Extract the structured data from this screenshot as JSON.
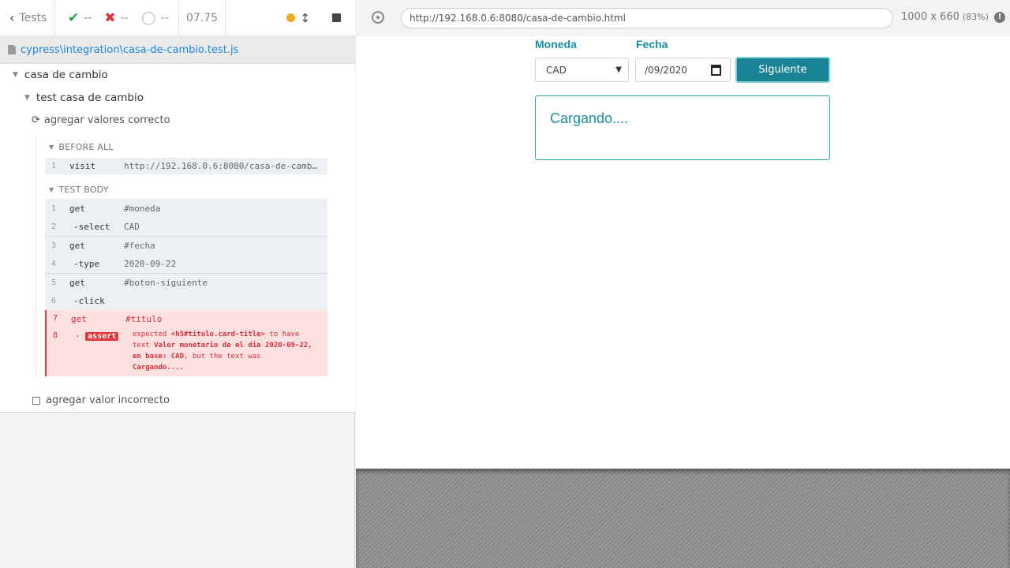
{
  "reporter": {
    "tests_label": "Tests",
    "passed": "--",
    "failed": "--",
    "pending": "--",
    "duration": "07.75",
    "spec_file": "cypress\\integration\\casa-de-cambio.test.js",
    "suite": "casa de cambio",
    "subsuite": "test casa de cambio",
    "test_active": "agregar valores correcto",
    "test_other": "agregar valor incorrecto",
    "before_all_label": "BEFORE ALL",
    "test_body_label": "TEST BODY",
    "before_all_cmds": [
      {
        "num": "1",
        "name": "visit",
        "msg": "http://192.168.0.6:8080/casa-de-cambio.html"
      }
    ],
    "body_cmds": [
      {
        "num": "1",
        "name": "get",
        "msg": "#moneda"
      },
      {
        "num": "2",
        "name": "-select",
        "msg": "CAD"
      },
      {
        "num": "3",
        "name": "get",
        "msg": "#fecha"
      },
      {
        "num": "4",
        "name": "-type",
        "msg": "2020-09-22"
      },
      {
        "num": "5",
        "name": "get",
        "msg": "#boton-siguiente"
      },
      {
        "num": "6",
        "name": "-click",
        "msg": ""
      },
      {
        "num": "7",
        "name": "get",
        "msg": "#titulo"
      },
      {
        "num": "8",
        "name": "-",
        "badge": "assert"
      }
    ],
    "error": {
      "w1": "expected",
      "w2": "<h5#titulo.card-title>",
      "w3": "to have",
      "w4": "text",
      "w5": "Valor monetario de el dia 2020-09-22,",
      "w6": "en base: CAD",
      "w7": ", but the text was",
      "w8": "Cargando...."
    },
    "colors": {
      "pass": "#27a644",
      "fail": "#e2353e",
      "link": "#1e87d6"
    }
  },
  "browser": {
    "url": "http://192.168.0.6:8080/casa-de-cambio.html",
    "viewport": "1000 x 660",
    "scale": "(83%)"
  },
  "app": {
    "moneda_label": "Moneda",
    "fecha_label": "Fecha",
    "moneda_value": "CAD",
    "fecha_value": "/09/2020",
    "button_label": "Siguiente",
    "card_title": "Cargando....",
    "accent": "#1a8fa0"
  },
  "icons": [
    "chevron-left-icon",
    "check-icon",
    "x-icon",
    "circle-pending-icon",
    "scroll-icon",
    "stop-icon",
    "file-icon",
    "triangle-down-icon",
    "refresh-icon",
    "checkbox-icon",
    "crosshair-icon",
    "info-icon",
    "calendar-icon",
    "select-arrow-icon"
  ]
}
